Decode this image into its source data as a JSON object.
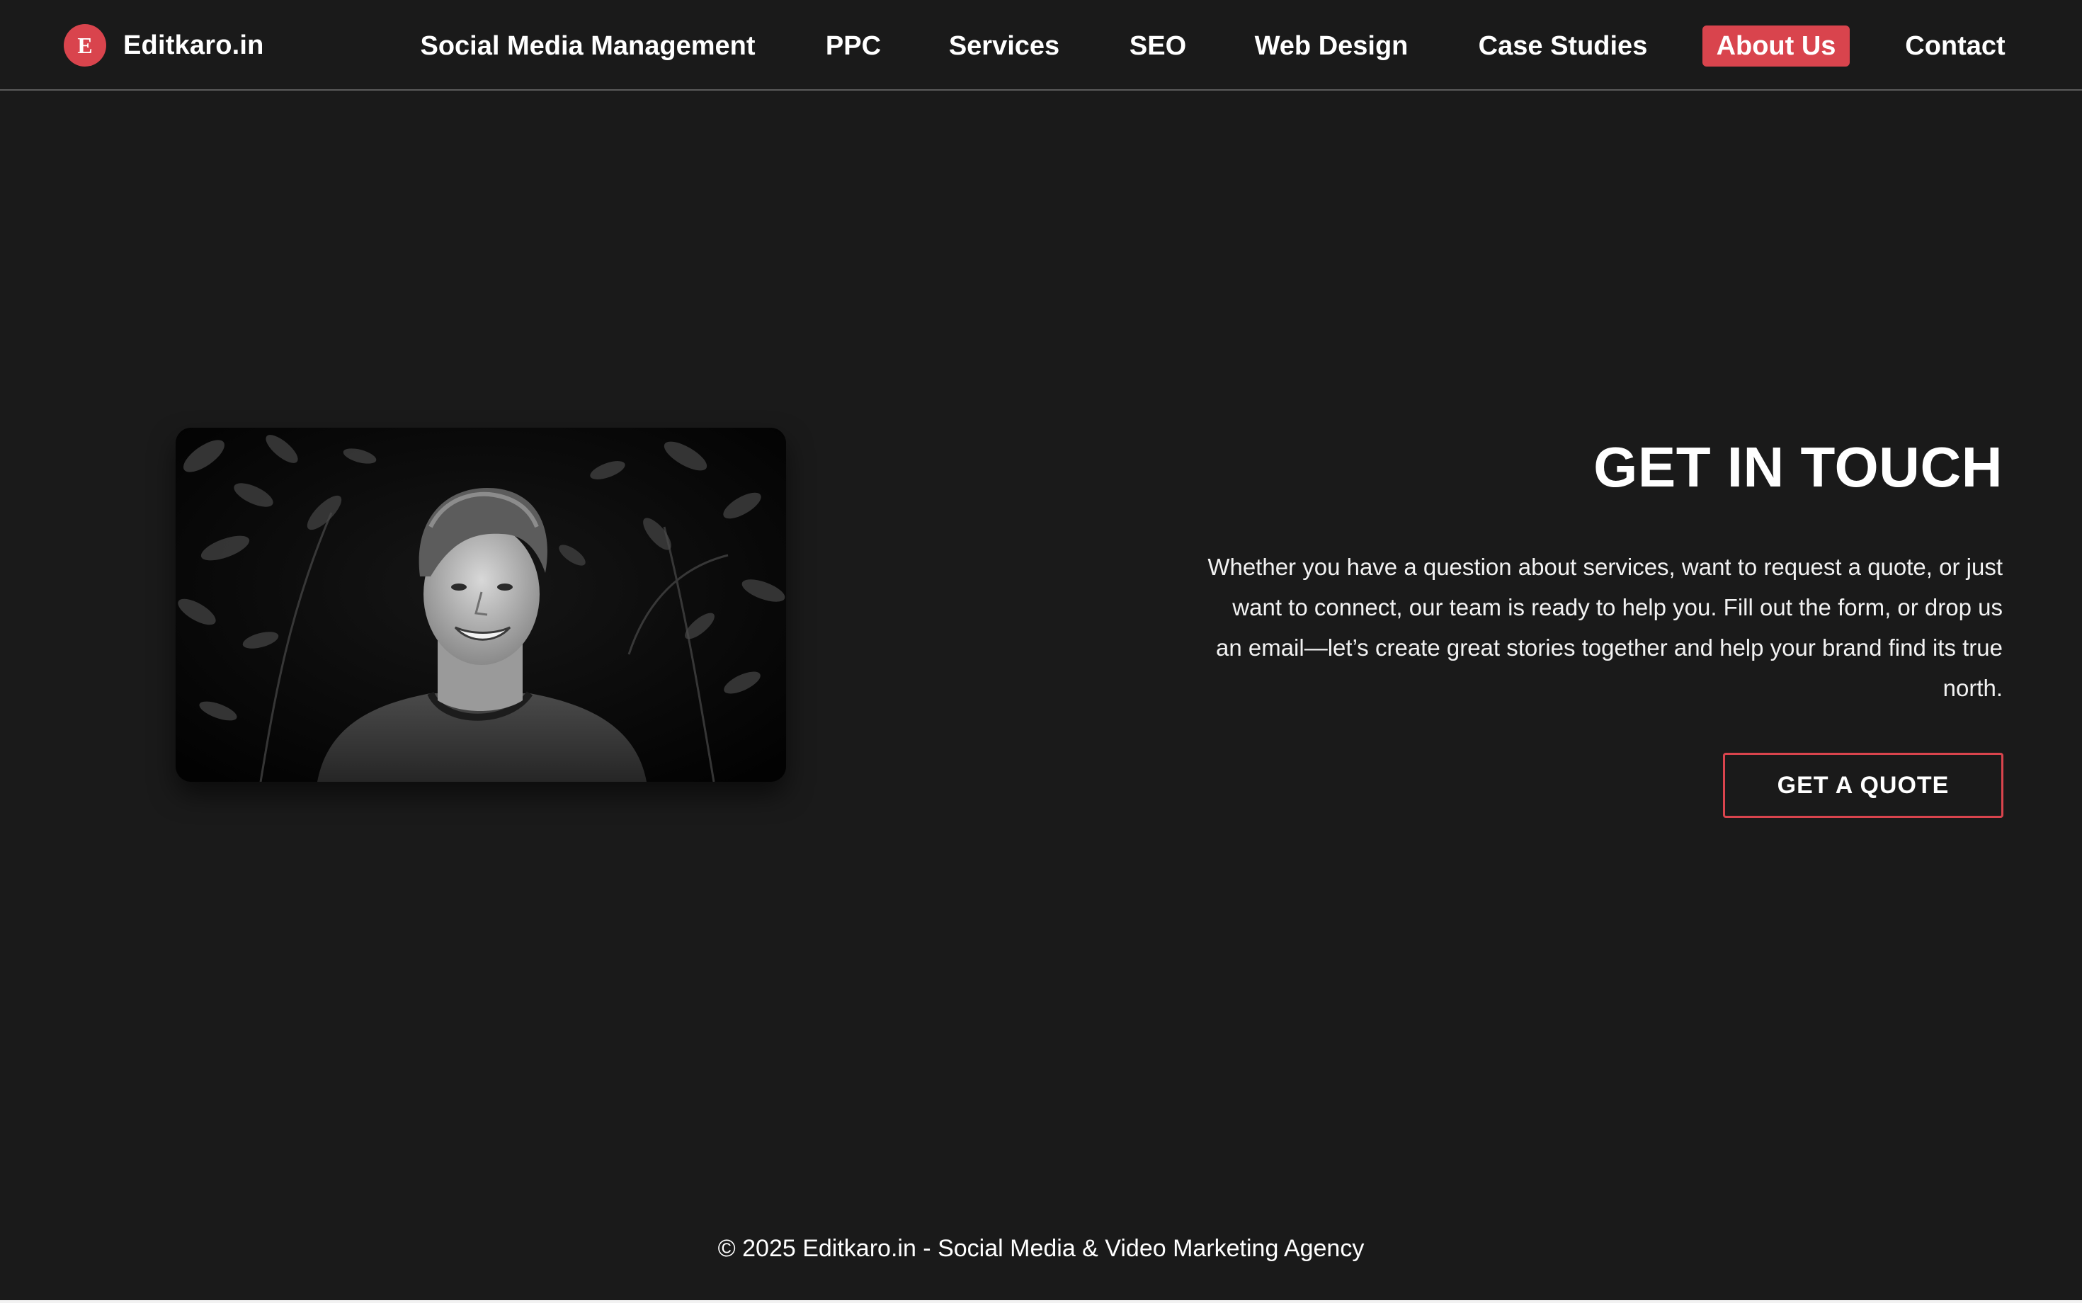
{
  "brand": {
    "logo_letter": "E",
    "name": "Editkaro.in",
    "accent_color": "#d9444d"
  },
  "nav": {
    "items": [
      {
        "label": "Social Media Management"
      },
      {
        "label": "PPC"
      },
      {
        "label": "Services"
      },
      {
        "label": "SEO"
      },
      {
        "label": "Web Design"
      },
      {
        "label": "Case Studies"
      },
      {
        "label": "About Us",
        "active": true
      },
      {
        "label": "Contact"
      }
    ]
  },
  "hero": {
    "image": {
      "icon": "portrait-photo",
      "style": "black-and-white"
    },
    "title": "GET IN TOUCH",
    "description": "Whether you have a question about services, want to request a quote, or just want to connect, our team is ready to help you. Fill out the form, or drop us an email—let’s create great stories together and help your brand find its true north.",
    "cta_label": "GET A QUOTE"
  },
  "footer": {
    "text": "© 2025 Editkaro.in - Social Media & Video Marketing Agency"
  },
  "colors": {
    "background": "#1a1a1a",
    "text": "#ffffff",
    "accent": "#d9444d"
  }
}
